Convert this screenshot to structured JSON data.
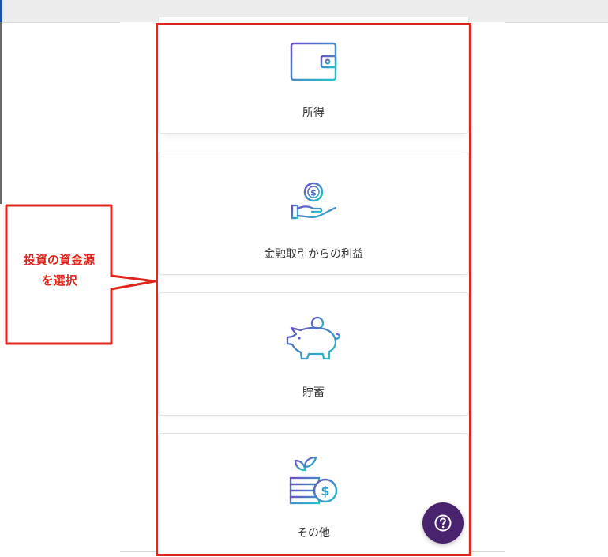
{
  "callout": {
    "text": "投資の資金源\nを選択",
    "line1": "投資の資金源",
    "line2": "を選択",
    "color": "#e0261c"
  },
  "sources": [
    {
      "label": "所得",
      "icon": "wallet-icon"
    },
    {
      "label": "金融取引からの利益",
      "icon": "coin-hand-icon"
    },
    {
      "label": "貯蓄",
      "icon": "piggy-bank-icon"
    },
    {
      "label": "その他",
      "icon": "plant-coin-icon"
    }
  ],
  "help": {
    "icon": "help-icon",
    "color": "#4a236e"
  },
  "colors": {
    "icon_gradient_start": "#6a4fc4",
    "icon_gradient_end": "#22c4c9",
    "highlight": "#e0261c"
  }
}
